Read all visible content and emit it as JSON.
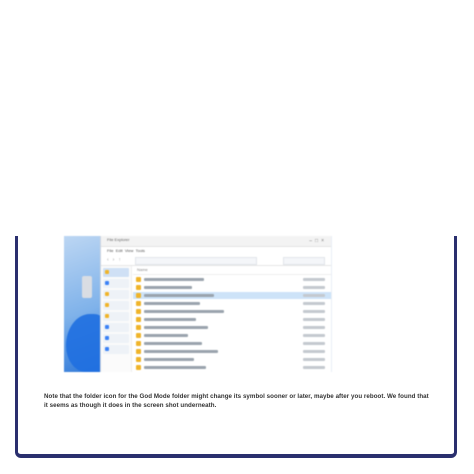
{
  "screenshot": {
    "window_title": "File Explorer",
    "menu": [
      "File",
      "Edit",
      "View",
      "Tools"
    ],
    "file_rows": [
      {
        "selected": false
      },
      {
        "selected": false
      },
      {
        "selected": true
      },
      {
        "selected": false
      },
      {
        "selected": false
      },
      {
        "selected": false
      },
      {
        "selected": false
      },
      {
        "selected": false
      },
      {
        "selected": false
      },
      {
        "selected": false
      },
      {
        "selected": false
      },
      {
        "selected": false
      }
    ]
  },
  "caption": "Note that the folder icon for the God Mode folder might change its symbol sooner or later, maybe after you reboot. We found that it seems as though it does in the screen shot underneath.",
  "colors": {
    "frame_border": "#2a2f6e",
    "selection": "#cde3f8",
    "folder": "#f0b429"
  }
}
